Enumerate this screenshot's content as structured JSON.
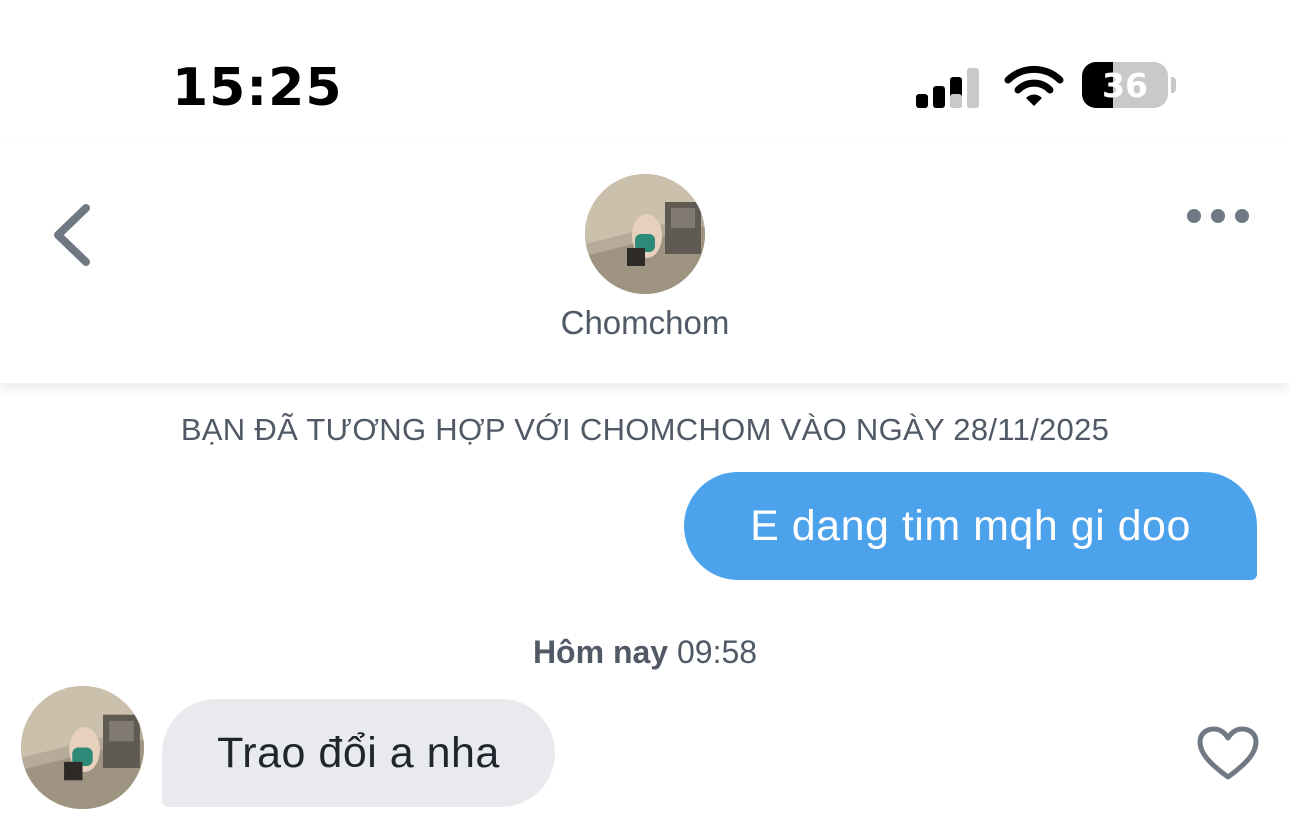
{
  "status_bar": {
    "time": "15:25",
    "battery_level": "36",
    "battery_fraction": 0.36,
    "icons": [
      "cellular-signal-icon",
      "wifi-icon",
      "battery-icon"
    ]
  },
  "header": {
    "contact_name": "Chomchom",
    "back_icon": "chevron-left-icon",
    "more_icon": "more-horizontal-icon"
  },
  "chat": {
    "match_notice": "BẠN ĐÃ TƯƠNG HỢP VỚI CHOMCHOM VÀO NGÀY 28/11/2025",
    "messages": [
      {
        "direction": "outgoing",
        "text": "E dang tim mqh gi doo"
      },
      {
        "direction": "incoming",
        "text": "Trao đổi a nha"
      }
    ],
    "timestamp": {
      "day": "Hôm nay",
      "time": "09:58"
    },
    "like_icon": "heart-outline-icon"
  },
  "colors": {
    "outgoing_bubble": "#4ca3ec",
    "incoming_bubble": "#e9eaee",
    "secondary_text": "#505965",
    "icon_gray": "#6f7883"
  }
}
